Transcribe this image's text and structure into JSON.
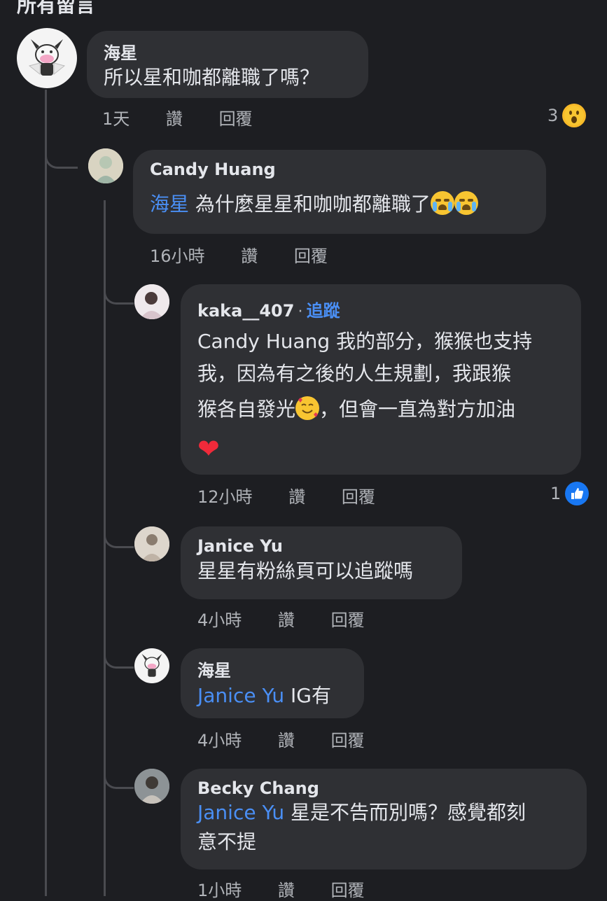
{
  "section_title": "所有留言",
  "comments": [
    {
      "author": "海星",
      "text": "所以星和咖都離職了嗎？",
      "time": "1天",
      "like": "讚",
      "reply": "回覆",
      "reaction": {
        "count": "3",
        "type": "wow-reaction-icon",
        "color": "#f7b928"
      }
    },
    {
      "author": "Candy Huang",
      "mention": "海星",
      "text": "為什麼星星和咖咖都離職了",
      "emoji": [
        "crying-face",
        "crying-face"
      ],
      "time": "16小時",
      "like": "讚",
      "reply": "回覆"
    },
    {
      "author": "kaka__407",
      "separator": "·",
      "follow": "追蹤",
      "lines": [
        "Candy Huang 我的部分，猴猴也支持",
        "我，因為有之後的人生規劃，我跟猴",
        "猴各自發光",
        "，但會一直為對方加油"
      ],
      "emoji": [
        "smiling-face-with-hearts",
        "red-heart"
      ],
      "time": "12小時",
      "like": "讚",
      "reply": "回覆",
      "reaction": {
        "count": "1",
        "type": "like-reaction-icon",
        "color": "#1877f2"
      }
    },
    {
      "author": "Janice Yu",
      "text": "星星有粉絲頁可以追蹤嗎",
      "time": "4小時",
      "like": "讚",
      "reply": "回覆"
    },
    {
      "author": "海星",
      "mention": "Janice Yu",
      "text": "IG有",
      "time": "4小時",
      "like": "讚",
      "reply": "回覆"
    },
    {
      "author": "Becky Chang",
      "mention": "Janice Yu",
      "text_line1": "星是不告而別嗎？感覺都刻",
      "text_line2": "意不提",
      "time": "1小時",
      "like": "讚",
      "reply": "回覆"
    }
  ]
}
